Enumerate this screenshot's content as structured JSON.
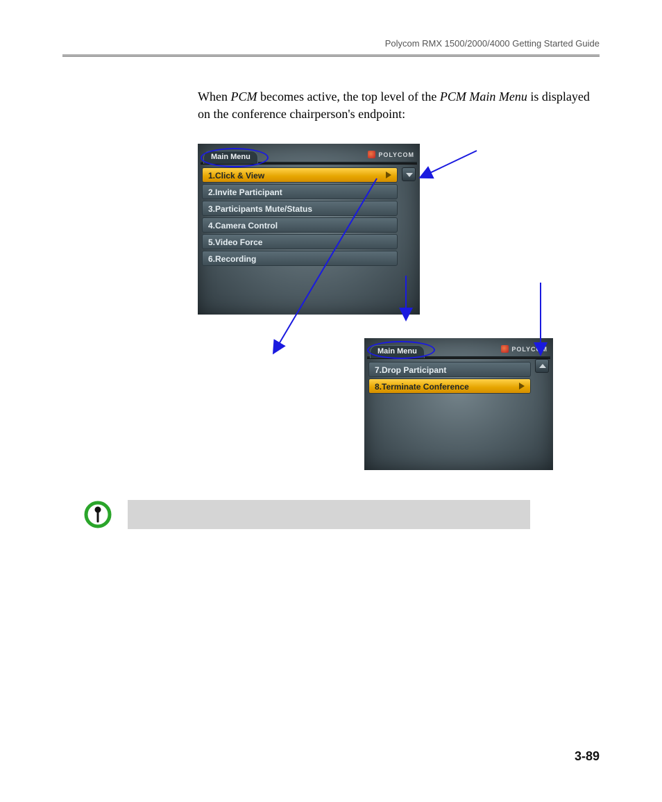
{
  "header": {
    "title": "Polycom RMX 1500/2000/4000 Getting Started Guide"
  },
  "body": {
    "before": "When ",
    "ital1": "PCM",
    "mid": " becomes active, the top level of the ",
    "ital2": "PCM Main Menu",
    "after": " is displayed on the conference chairperson's endpoint:"
  },
  "panel1": {
    "title": "Main Menu",
    "brand": "POLYCOM",
    "items": [
      "1.Click & View",
      "2.Invite Participant",
      "3.Participants Mute/Status",
      "4.Camera Control",
      "5.Video Force",
      "6.Recording"
    ],
    "selected_index": 0,
    "scroll": "down"
  },
  "panel2": {
    "title": "Main Menu",
    "brand": "POLYCOM",
    "items": [
      "7.Drop Participant",
      "8.Terminate Conference"
    ],
    "selected_index": 1,
    "scroll": "up"
  },
  "page_number": "3-89"
}
